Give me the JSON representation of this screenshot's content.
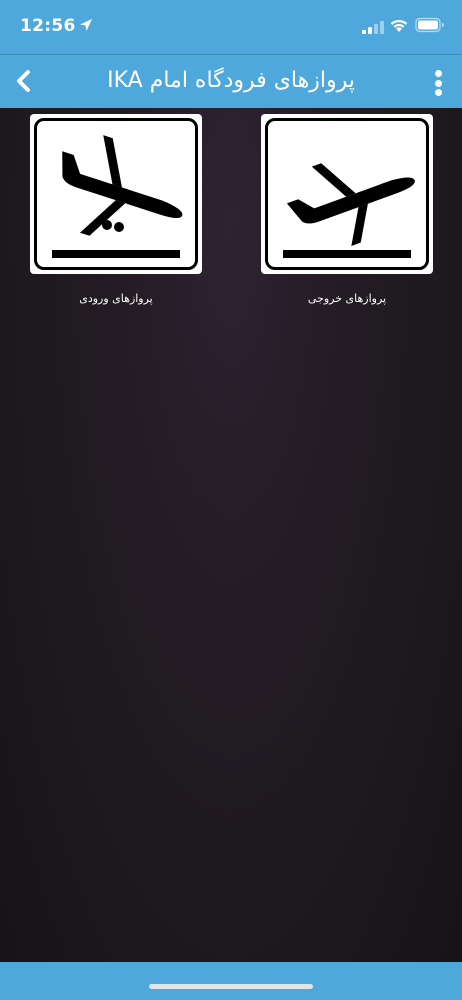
{
  "status_bar": {
    "time": "12:56",
    "icons": [
      "location-arrow-icon",
      "cellular-signal-icon",
      "wifi-icon",
      "battery-icon"
    ]
  },
  "app_bar": {
    "title": "پروازهای فرودگاه امام IKA",
    "back_icon": "chevron-left-icon",
    "menu_icon": "more-vertical-icon"
  },
  "tiles": [
    {
      "label": "پروازهای ورودی",
      "icon": "airplane-arrival-icon"
    },
    {
      "label": "پروازهای خروجی",
      "icon": "airplane-departure-icon"
    }
  ],
  "colors": {
    "app_bar": "#4fa8db",
    "background": "#1e1a1f",
    "tile_background": "#ffffff",
    "icon": "#000000"
  }
}
